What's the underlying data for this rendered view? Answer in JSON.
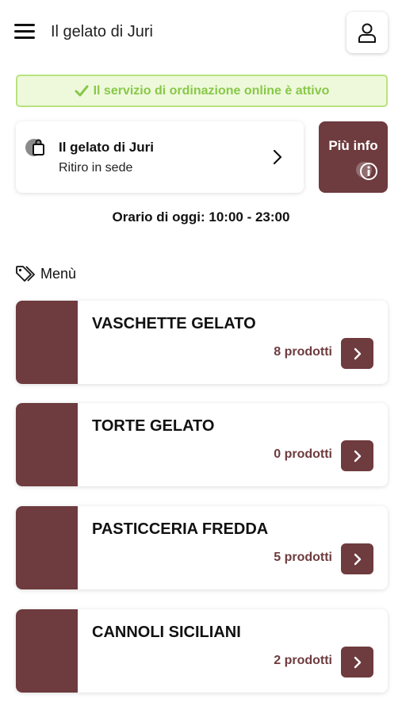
{
  "header": {
    "title": "Il gelato di Juri",
    "menu_icon": "hamburger-menu-icon",
    "user_icon": "user-icon"
  },
  "status": {
    "text": "Il servizio di ordinazione online è attivo",
    "icon": "check-icon"
  },
  "store": {
    "name": "Il gelato di Juri",
    "mode": "Ritiro in sede",
    "icon": "shopping-bag-icon"
  },
  "info_button": {
    "label": "Più info",
    "icon": "info-icon"
  },
  "hours": {
    "text": "Orario di oggi: 10:00 - 23:00"
  },
  "menu": {
    "heading": "Menù",
    "icon": "tag-icon",
    "categories": [
      {
        "name": "VASCHETTE GELATO",
        "count": "8 prodotti"
      },
      {
        "name": "TORTE GELATO",
        "count": "0 prodotti"
      },
      {
        "name": "PASTICCERIA FREDDA",
        "count": "5 prodotti"
      },
      {
        "name": "CANNOLI SICILIANI",
        "count": "2 prodotti"
      }
    ]
  },
  "colors": {
    "brand": "#6e3b3e",
    "status_green": "#88c848",
    "status_bg": "#eef9dc",
    "status_border": "#b8e27e"
  }
}
